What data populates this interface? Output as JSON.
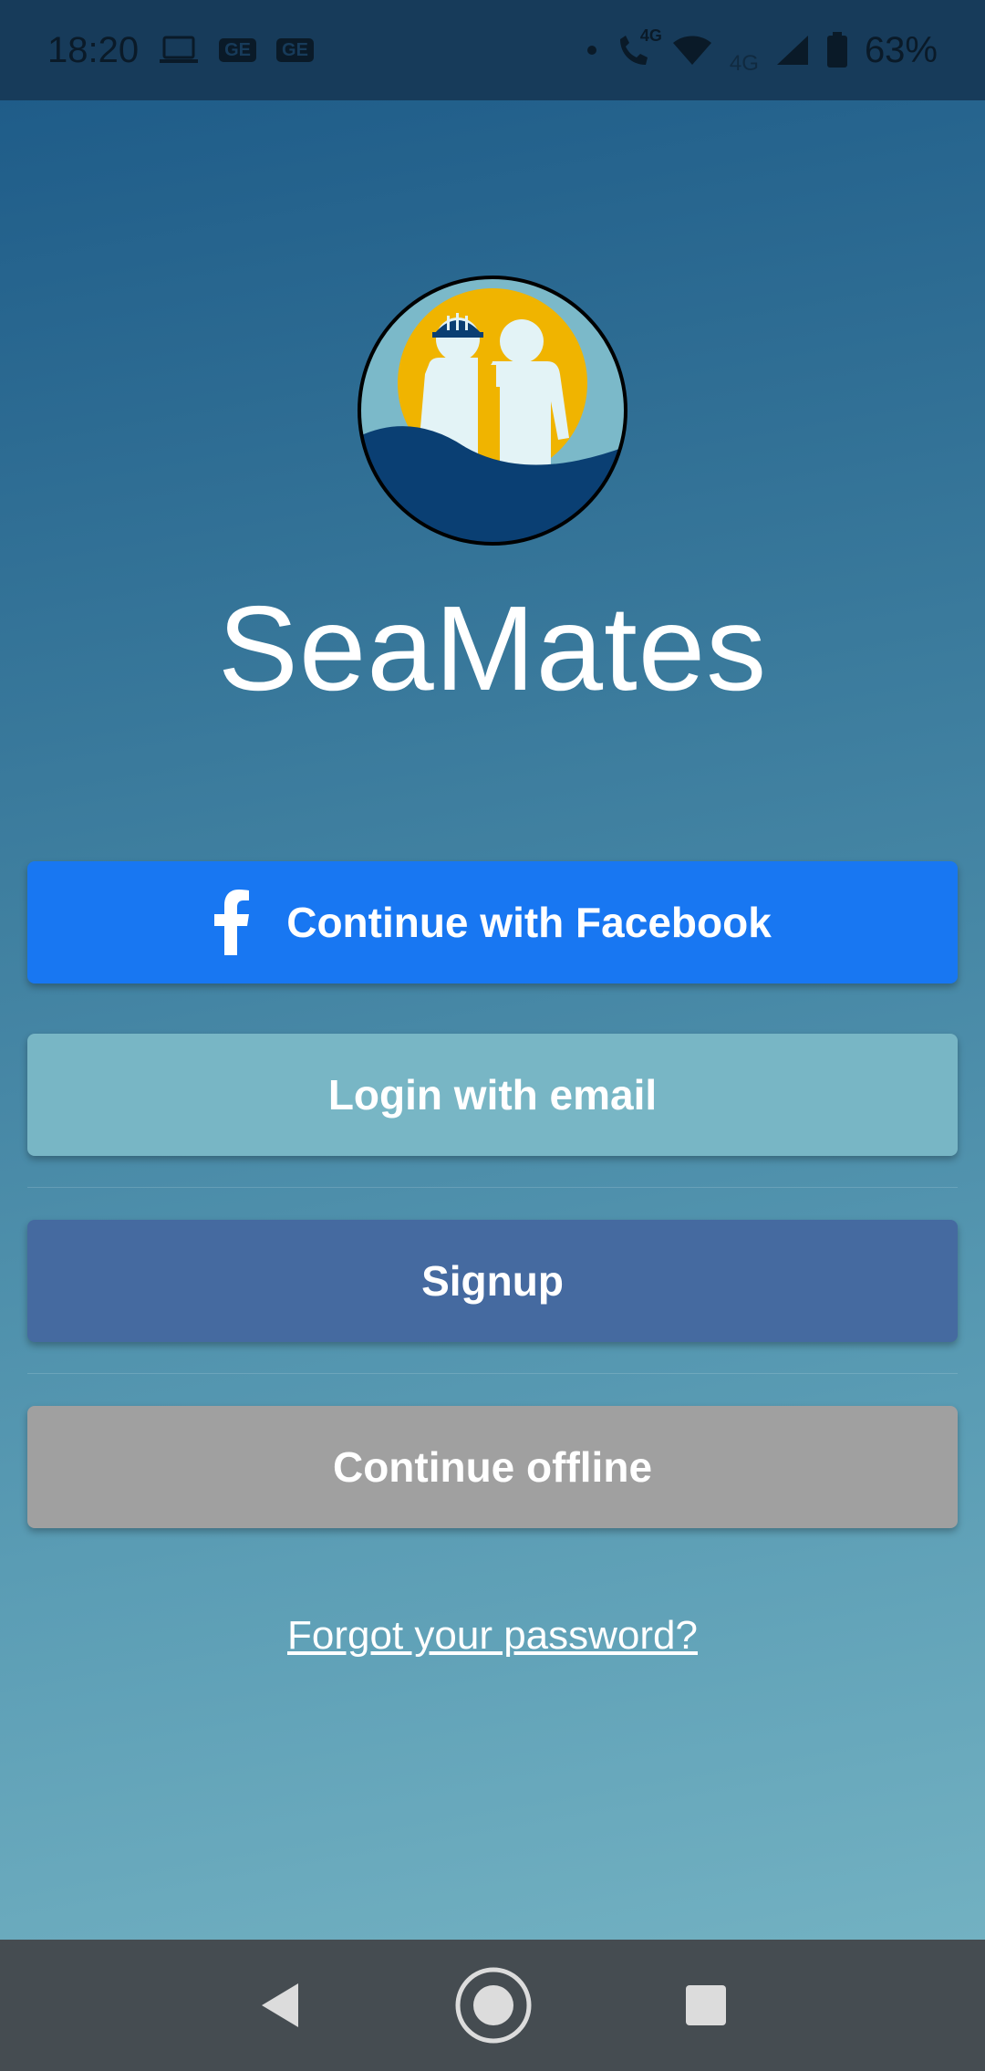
{
  "status_bar": {
    "time": "18:20",
    "battery": "63%",
    "network_label_1": "4G",
    "network_label_2": "4G",
    "icons": [
      "laptop-icon",
      "ge-badge-icon",
      "ge-badge-icon",
      "dot-icon",
      "volte-call-icon",
      "wifi-icon",
      "signal-icon",
      "battery-icon"
    ],
    "badge_text": "GE"
  },
  "app": {
    "title": "SeaMates",
    "logo_icon": "seamates-logo"
  },
  "buttons": {
    "facebook_label": "Continue with Facebook",
    "email_label": "Login with email",
    "signup_label": "Signup",
    "offline_label": "Continue offline"
  },
  "links": {
    "forgot_password": "Forgot your password?"
  },
  "nav": {
    "icons": [
      "back-icon",
      "home-icon",
      "recents-icon"
    ]
  },
  "colors": {
    "facebook": "#1877f2",
    "email": "#78b6c5",
    "signup": "#456aa0",
    "offline": "#a0a0a0",
    "logo_sun": "#f0b400",
    "logo_sea": "#0a3f73",
    "logo_sky": "#7bb9c9"
  }
}
